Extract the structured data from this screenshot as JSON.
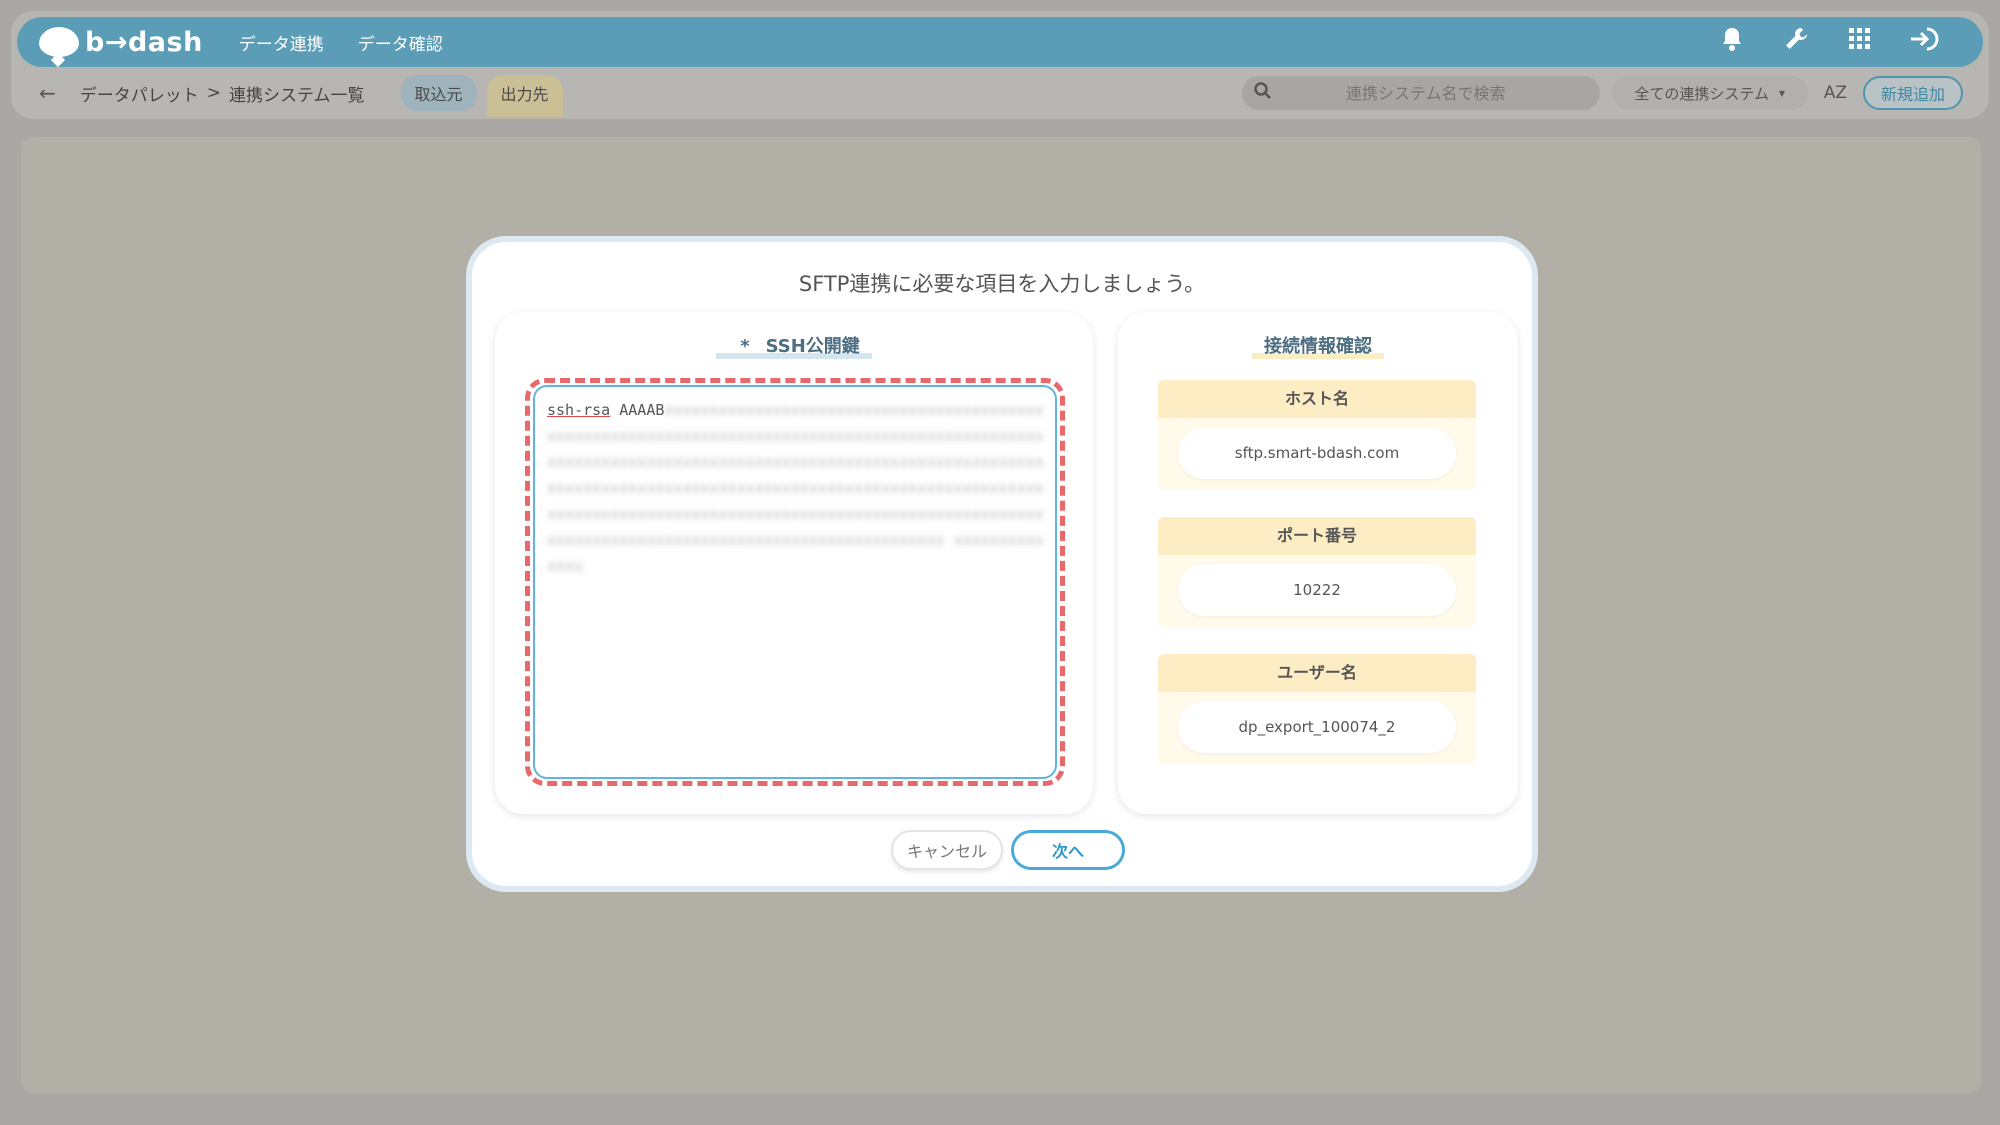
{
  "header": {
    "logo_text": "b→dash",
    "nav": [
      "データ連携",
      "データ確認"
    ],
    "icons": [
      "bell-icon",
      "wrench-icon",
      "grid-icon",
      "logout-icon"
    ]
  },
  "subbar": {
    "back_icon": "←",
    "breadcrumb": [
      "データパレット",
      "連携システム一覧"
    ],
    "breadcrumb_sep": ">",
    "tabs": [
      "取込元",
      "出力先"
    ],
    "search_placeholder": "連携システム名で検索",
    "filter_value": "全ての連携システム",
    "sort_label": "AZ",
    "new_button": "新規追加"
  },
  "modal": {
    "title": "SFTP連携に必要な項目を入力しましょう。",
    "ssh_card": {
      "required_mark": "*",
      "heading": "SSH公開鍵",
      "key_prefix": "ssh-rsa",
      "key_start": "AAAAB"
    },
    "info_card": {
      "heading": "接続情報確認",
      "host_label": "ホスト名",
      "host_value": "sftp.smart-bdash.com",
      "port_label": "ポート番号",
      "port_value": "10222",
      "user_label": "ユーザー名",
      "user_value": "dp_export_100074_2"
    },
    "cancel_button": "キャンセル",
    "next_button": "次へ"
  },
  "colors": {
    "navbar": "#5b9db6",
    "dash_highlight": "#e8696b",
    "textarea_border": "#62b4de",
    "info_label_bg": "#fdedc4",
    "next_button": "#4aa9d8"
  }
}
